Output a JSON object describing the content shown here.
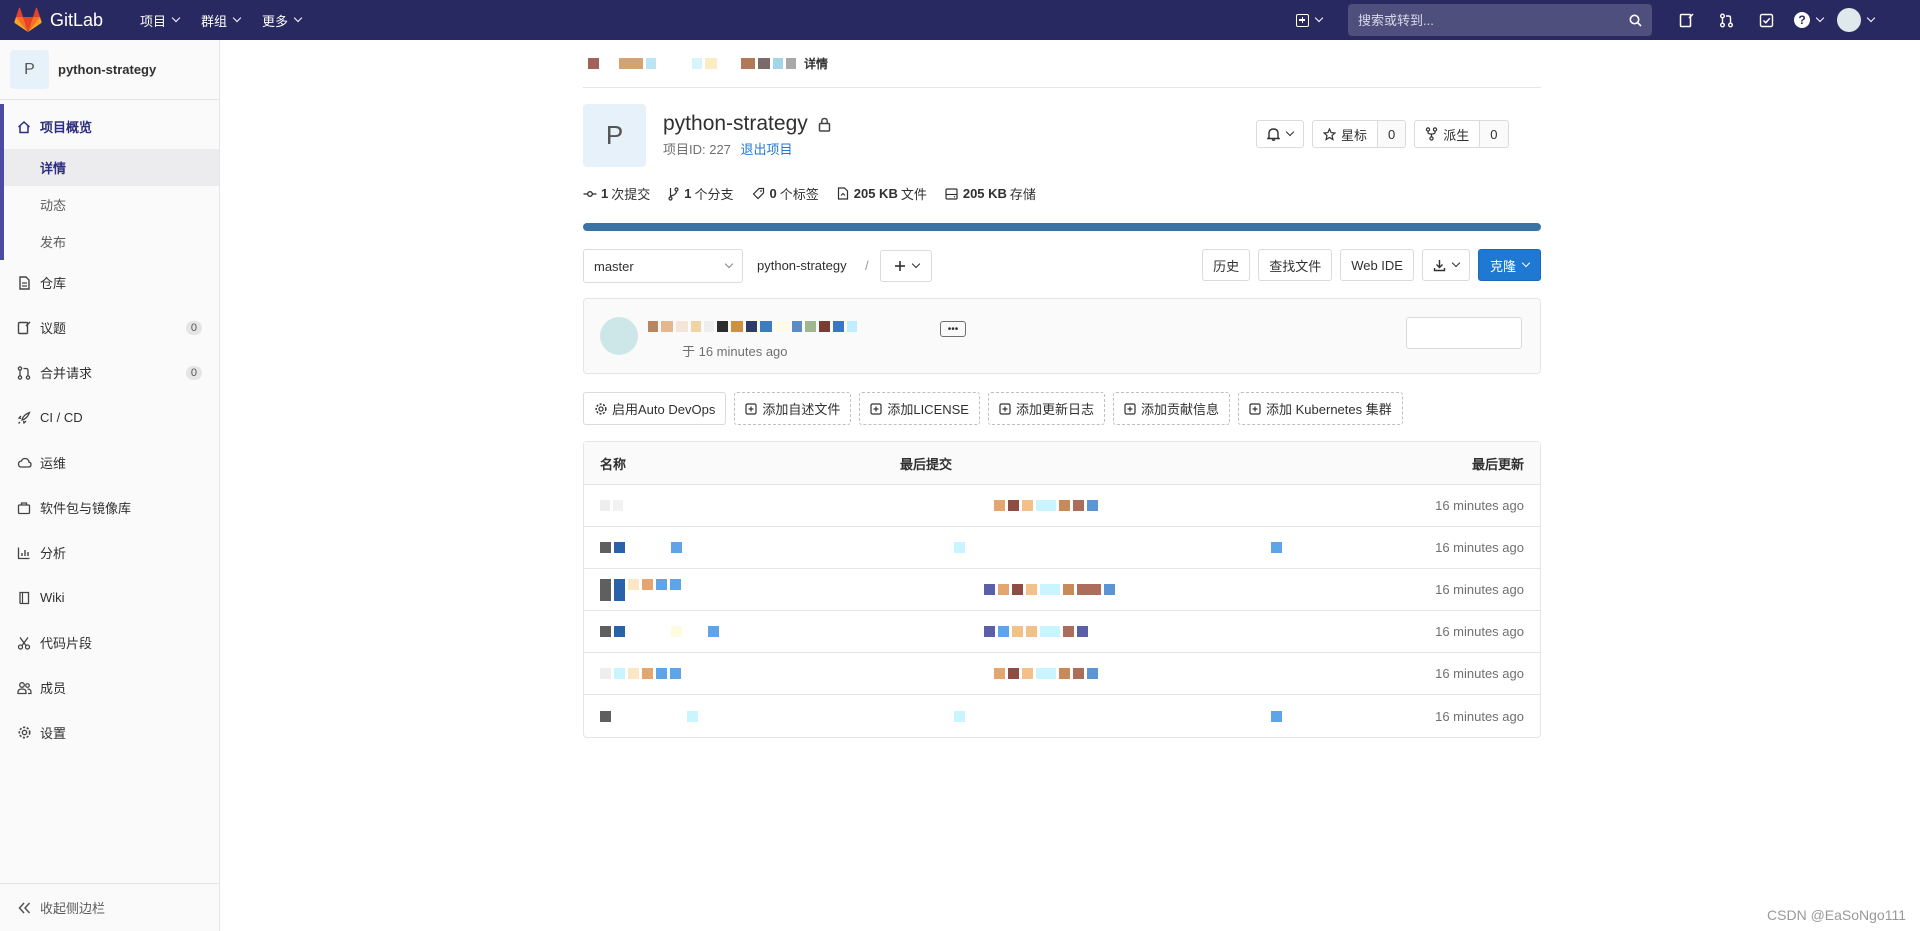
{
  "navbar": {
    "brand": "GitLab",
    "menu": [
      {
        "label": "项目"
      },
      {
        "label": "群组"
      },
      {
        "label": "更多"
      }
    ],
    "search_placeholder": "搜索或转到..."
  },
  "sidebar": {
    "project_initial": "P",
    "project_name": "python-strategy",
    "overview": {
      "label": "项目概览",
      "subitems": [
        {
          "label": "详情"
        },
        {
          "label": "动态"
        },
        {
          "label": "发布"
        }
      ]
    },
    "items": [
      {
        "label": "仓库",
        "icon": "doc-icon"
      },
      {
        "label": "议题",
        "icon": "issues-icon",
        "badge": "0"
      },
      {
        "label": "合并请求",
        "icon": "merge-request-icon",
        "badge": "0"
      },
      {
        "label": "CI / CD",
        "icon": "rocket-icon"
      },
      {
        "label": "运维",
        "icon": "cloud-icon"
      },
      {
        "label": "软件包与镜像库",
        "icon": "package-icon"
      },
      {
        "label": "分析",
        "icon": "chart-icon"
      },
      {
        "label": "Wiki",
        "icon": "book-icon"
      },
      {
        "label": "代码片段",
        "icon": "snippet-icon"
      },
      {
        "label": "成员",
        "icon": "users-icon"
      },
      {
        "label": "设置",
        "icon": "settings-icon"
      }
    ],
    "collapse_label": "收起侧边栏"
  },
  "breadcrumb": {
    "current": "详情"
  },
  "project": {
    "initial": "P",
    "name": "python-strategy",
    "id_label": "项目ID: 227",
    "leave_label": "退出项目",
    "star_label": "星标",
    "star_count": "0",
    "fork_label": "派生",
    "fork_count": "0"
  },
  "stats": {
    "commits_count": "1",
    "commits_label": "次提交",
    "branches_count": "1",
    "branches_label": "个分支",
    "tags_count": "0",
    "tags_label": "个标签",
    "files_size": "205 KB",
    "files_label": "文件",
    "storage_size": "205 KB",
    "storage_label": "存储"
  },
  "toolbar": {
    "branch": "master",
    "path": "python-strategy",
    "separator": "/",
    "history": "历史",
    "find_file": "查找文件",
    "web_ide": "Web IDE",
    "clone": "克隆"
  },
  "commit": {
    "time_text": "于 16 minutes ago"
  },
  "suggestions": [
    {
      "label": "启用Auto DevOps"
    },
    {
      "label": "添加自述文件"
    },
    {
      "label": "添加LICENSE"
    },
    {
      "label": "添加更新日志"
    },
    {
      "label": "添加贡献信息"
    },
    {
      "label": "添加 Kubernetes 集群"
    }
  ],
  "file_table": {
    "headers": {
      "name": "名称",
      "last_commit": "最后提交",
      "last_update": "最后更新"
    },
    "rows": [
      {
        "time": "16 minutes ago"
      },
      {
        "time": "16 minutes ago"
      },
      {
        "time": "16 minutes ago"
      },
      {
        "time": "16 minutes ago"
      },
      {
        "time": "16 minutes ago"
      },
      {
        "time": "16 minutes ago"
      }
    ]
  },
  "watermark": "CSDN @EaSoNgo111",
  "colors": {
    "navbar": "#292961",
    "accent": "#1f78d1",
    "progress": "#3b73a4",
    "active_sidebar": "#4b4ba3"
  }
}
